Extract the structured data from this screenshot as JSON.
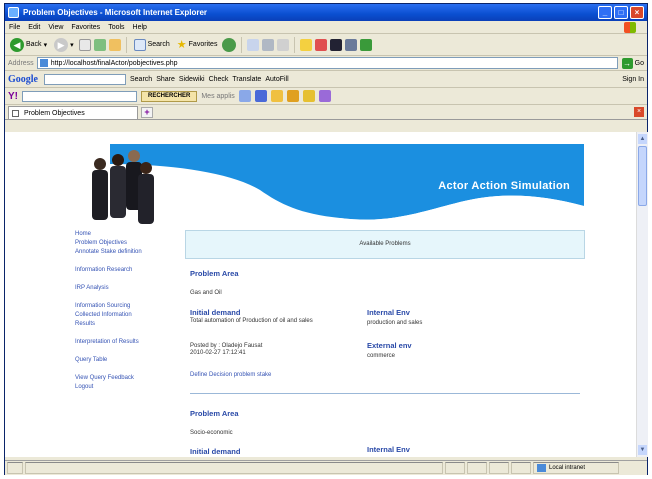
{
  "window": {
    "title": "Problem Objectives - Microsoft Internet Explorer"
  },
  "menu": [
    "File",
    "Edit",
    "View",
    "Favorites",
    "Tools",
    "Help"
  ],
  "toolbar": {
    "back": "Back",
    "search": "Search",
    "favorites": "Favorites"
  },
  "address": {
    "label": "Address",
    "url": "http://localhost/finalActor/pobjectives.php",
    "go": "Go"
  },
  "google_bar": {
    "logo": "Google",
    "items": [
      "Search",
      "Share",
      "Sidewiki",
      "Check",
      "Translate",
      "AutoFill"
    ],
    "signin": "Sign In"
  },
  "yahoo_bar": {
    "logo": "Y!",
    "button": "RECHERCHER",
    "myapps": "Mes applis"
  },
  "tab": {
    "label": "Problem Objectives"
  },
  "banner": {
    "title": "Actor Action Simulation"
  },
  "sidenav": [
    "Home",
    "Problem Objectives",
    "Annotate Stake definition",
    "",
    "Information Research",
    "",
    "IRP Analysis",
    "",
    "Information Sourcing",
    "Collected Information",
    "Results",
    "",
    "Interpretation of Results",
    "",
    "Query Table",
    "",
    "View Query Feedback",
    "Logout"
  ],
  "main": {
    "available": "Available Problems",
    "problems": [
      {
        "area_label": "Problem Area",
        "area": "Gas and Oil",
        "initial_label": "Initial demand",
        "initial": "Total automation of Production of oil and sales",
        "internal_label": "Internal Env",
        "internal": "production and sales",
        "posted": "Posted by : Oladejo Fausat",
        "date": "2010-02-27 17:12:41",
        "external_label": "External env",
        "external": "commerce",
        "define_link": "Define Decision problem stake"
      },
      {
        "area_label": "Problem Area",
        "area": "Socio-economic",
        "initial_label": "Initial demand",
        "internal_label": "Internal Env"
      }
    ]
  },
  "status": {
    "zone": "Local intranet"
  },
  "colors": {
    "accent": "#1b8fe0",
    "link": "#3553b4",
    "heading": "#2a4aa8",
    "panel": "#e6f6fb"
  }
}
